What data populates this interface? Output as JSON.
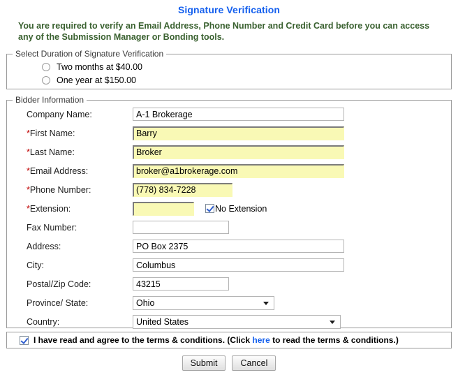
{
  "header": {
    "title": "Signature Verification",
    "description": "You are required to verify an Email Address, Phone Number and Credit Card before you can access any of the Submission Manager or Bonding tools.",
    "title_color": "#1560ee",
    "description_color": "#3a6130"
  },
  "duration": {
    "legend": "Select Duration of Signature Verification",
    "options": [
      {
        "label": "Two months at $40.00",
        "selected": false
      },
      {
        "label": "One year at $150.00",
        "selected": false
      }
    ]
  },
  "bidder": {
    "legend": "Bidder Information",
    "required_marker": "*",
    "fields": [
      {
        "label": "Company Name:",
        "required": false,
        "value": "A-1 Brokerage",
        "placeholder": "",
        "type": "text",
        "highlight": false
      },
      {
        "label": "First Name:",
        "required": true,
        "value": "Barry",
        "placeholder": "",
        "type": "text",
        "highlight": true
      },
      {
        "label": "Last Name:",
        "required": true,
        "value": "Broker",
        "placeholder": "",
        "type": "text",
        "highlight": true
      },
      {
        "label": "Email Address:",
        "required": true,
        "value": "broker@a1brokerage.com",
        "placeholder": "",
        "type": "text",
        "highlight": true
      },
      {
        "label": "Phone Number:",
        "required": true,
        "value": "(778) 834-7228",
        "placeholder": "",
        "type": "text",
        "highlight": true
      },
      {
        "label": "Extension:",
        "required": true,
        "value": "",
        "placeholder": "",
        "type": "text",
        "highlight": true
      },
      {
        "label": "Fax Number:",
        "required": false,
        "value": "",
        "placeholder": "",
        "type": "text",
        "highlight": false
      },
      {
        "label": "Address:",
        "required": false,
        "value": "PO Box 2375",
        "placeholder": "",
        "type": "text",
        "highlight": false
      },
      {
        "label": "City:",
        "required": false,
        "value": "Columbus",
        "placeholder": "",
        "type": "text",
        "highlight": false
      },
      {
        "label": "Postal/Zip Code:",
        "required": false,
        "value": "43215",
        "placeholder": "",
        "type": "text",
        "highlight": false
      },
      {
        "label": "Province/ State:",
        "required": false,
        "value": "Ohio",
        "placeholder": "",
        "type": "select",
        "highlight": false
      },
      {
        "label": "Country:",
        "required": false,
        "value": "United States",
        "placeholder": "",
        "type": "select",
        "highlight": false
      }
    ],
    "no_extension": {
      "label": "No Extension",
      "checked": true
    }
  },
  "terms": {
    "checked": true,
    "text_before": "I have read and agree to the terms & conditions. (Click",
    "link_label": "here",
    "text_after": "to read the terms & conditions.)",
    "link_color": "#1560ee"
  },
  "actions": {
    "submit_label": "Submit",
    "cancel_label": "Cancel"
  }
}
